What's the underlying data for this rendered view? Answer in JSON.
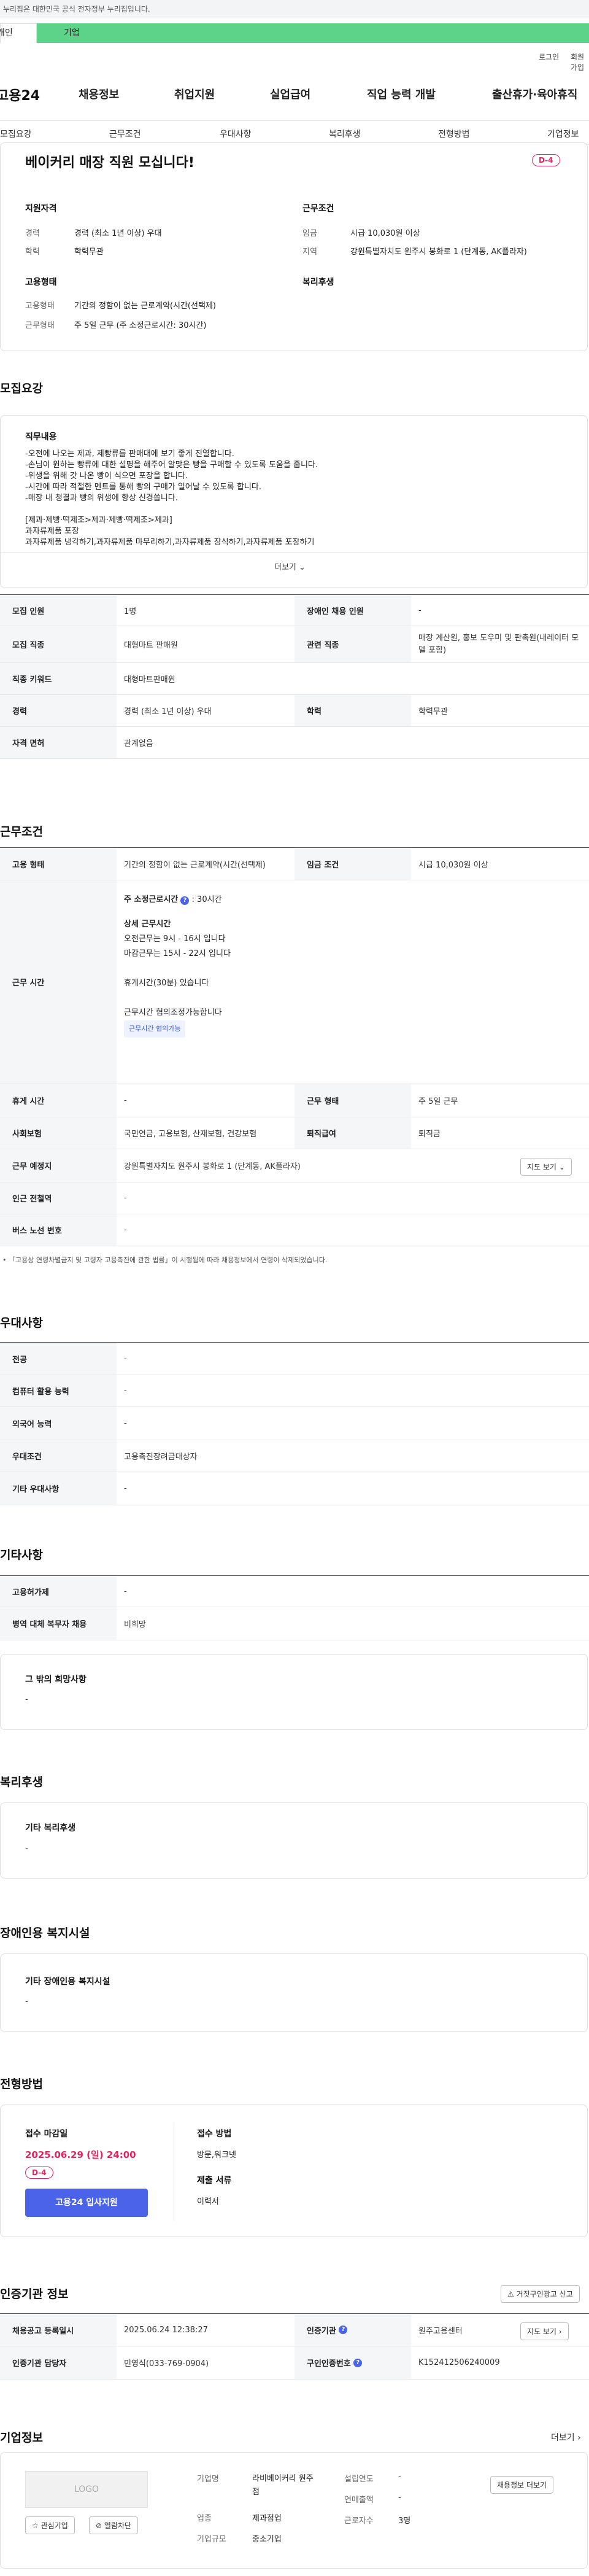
{
  "gov_banner": "이 누리집은 대한민국 공식 전자정부 누리집입니다.",
  "tabs": [
    "개인",
    "기업"
  ],
  "util": {
    "login": "로그인",
    "join": "회원가입"
  },
  "logo": "고용24",
  "gnb": [
    "채용정보",
    "취업지원",
    "실업급여",
    "직업 능력 개발",
    "출산휴가·육아휴직"
  ],
  "subnav": [
    "모집요강",
    "근무조건",
    "우대사항",
    "복리후생",
    "전형방법",
    "기업정보"
  ],
  "header_card": {
    "title": "베이커리 매장 직원 모십니다!",
    "dday": "D-4",
    "qual_title": "지원자격",
    "cond_title": "근무조건",
    "career_k": "경력",
    "career_v": "경력 (최소 1년 이상) 우대",
    "edu_k": "학력",
    "edu_v": "학력무관",
    "wage_k": "임금",
    "wage_v": "시급 10,030원 이상",
    "region_k": "지역",
    "region_v": "강원특별자치도 원주시 봉화로 1 (단계동, AK플라자)",
    "emp_title": "고용형태",
    "welfare_title": "복리후생",
    "emptype_k": "고용형태",
    "emptype_v": "기간의 정함이 없는 근로계약(시간(선택제)",
    "worktype_k": "근무형태",
    "worktype_v": "주 5일 근무 (주 소정근로시간: 30시간)"
  },
  "recruit": {
    "section": "모집요강",
    "duty_title": "직무내용",
    "lines": [
      "-오전에 나오는 제과, 제빵류를 판매대에 보기 좋게 진열합니다.",
      "-손님이 원하는 빵류에 대한 설명을 해주어 알맞은 빵을 구매할 수 있도록 도움을 줍니다.",
      "-위생을 위해 갓 나온 빵이 식으면 포장을 합니다.",
      "-시간에 따라 적절한 멘트를 통해 빵의 구매가 일어날 수 있도록 합니다.",
      "-매장 내 청결과 빵의 위생에 항상 신경씁니다.",
      "",
      "[제과·제빵·떡제조>제과·제빵·떡제조>제과]",
      "과자류제품 포장",
      "과자류제품 냉각하기,과자류제품 마무리하기,과자류제품 장식하기,과자류제품 포장하기"
    ],
    "more": "더보기",
    "rows": [
      {
        "k": "모집 인원",
        "v": "1명",
        "k2": "장애인 채용 인원",
        "v2": "-"
      },
      {
        "k": "모집 직종",
        "v": "대형마트 판매원",
        "k2": "관련 직종",
        "v2": "매장 계산원, 홍보 도우미 및 판촉원(내레이터 모델 포함)"
      },
      {
        "k": "직종 키워드",
        "v": "대형마트판매원"
      },
      {
        "k": "경력",
        "v": "경력 (최소 1년 이상) 우대",
        "k2": "학력",
        "v2": "학력무관"
      },
      {
        "k": "자격 면허",
        "v": "관계없음"
      }
    ]
  },
  "cond": {
    "section": "근무조건",
    "emptype_k": "고용 형태",
    "emptype_v": "기간의 정함이 없는 근로계약(시간(선택제)",
    "wage_k": "임금 조건",
    "wage_v": "시급 10,030원 이상",
    "time_k": "근무 시간",
    "weekly_label": "주 소정근로시간",
    "weekly_val": ": 30시간",
    "detail_title": "상세 근무시간",
    "detail": [
      "오전근무는 9시 - 16시 입니다",
      "마감근무는 15시 - 22시 입니다",
      "",
      "휴게시간(30분) 있습니다",
      "",
      "근무시간 협의조정가능합니다"
    ],
    "time_tag": "근무시간 협의가능",
    "rest_k": "휴게 시간",
    "rest_v": "-",
    "form_k": "근무 형태",
    "form_v": "주 5일 근무",
    "ins_k": "사회보험",
    "ins_v": "국민연금, 고용보험, 산재보험, 건강보험",
    "sev_k": "퇴직급여",
    "sev_v": "퇴직금",
    "place_k": "근무 예정지",
    "place_v": "강원특별자치도 원주시 봉화로 1 (단계동, AK플라자)",
    "map_btn": "지도 보기",
    "subway_k": "인근 전철역",
    "subway_v": "-",
    "bus_k": "버스 노선 번호",
    "bus_v": "-",
    "note": "「고용상 연령차별금지 및 고령자 고용촉진에 관한 법률」이 시행됨에 따라 채용정보에서 연령이 삭제되었습니다."
  },
  "pref": {
    "section": "우대사항",
    "rows": [
      {
        "k": "전공",
        "v": "-"
      },
      {
        "k": "컴퓨터 활용 능력",
        "v": "-"
      },
      {
        "k": "외국어 능력",
        "v": "-"
      },
      {
        "k": "우대조건",
        "v": "고용촉진장려금대상자"
      },
      {
        "k": "기타 우대사항",
        "v": "-"
      }
    ]
  },
  "etc": {
    "section": "기타사항",
    "rows": [
      {
        "k": "고용허가제",
        "v": "-"
      },
      {
        "k": "병역 대체 복무자 채용",
        "v": "비희망"
      }
    ],
    "wish_title": "그 밖의 희망사항",
    "wish_v": "-"
  },
  "welfare": {
    "section": "복리후생",
    "box_title": "기타 복리후생",
    "box_v": "-"
  },
  "disabled": {
    "section": "장애인용 복지시설",
    "box_title": "기타 장애인용 복지시설",
    "box_v": "-"
  },
  "process": {
    "section": "전형방법",
    "deadline_title": "접수 마감일",
    "deadline": "2025.06.29 (일) 24:00",
    "dday": "D-4",
    "apply_btn": "고용24 입사지원",
    "method_title": "접수 방법",
    "method_v": "방문,워크넷",
    "docs_title": "제출 서류",
    "docs_v": "이력서"
  },
  "cert": {
    "section": "인증기관 정보",
    "report_btn": "거짓구인광고 신고",
    "reg_k": "채용공고 등록일시",
    "reg_v": "2025.06.24 12:38:27",
    "org_k": "인증기관",
    "org_v": "원주고용센터",
    "map_btn": "지도 보기",
    "mgr_k": "인증기관 담당자",
    "mgr_v": "민영식(033-769-0904)",
    "no_k": "구인인증번호",
    "no_v": "K152412506240009"
  },
  "company": {
    "section": "기업정보",
    "more": "더보기",
    "logo": "LOGO",
    "fav_btn": "관심기업",
    "block_btn": "열람차단",
    "name_k": "기업명",
    "name_v": "라비베이커리 원주점",
    "ind_k": "업종",
    "ind_v": "제과점업",
    "size_k": "기업규모",
    "size_v": "중소기업",
    "year_k": "설립연도",
    "year_v": "-",
    "sales_k": "연매출액",
    "sales_v": "-",
    "staff_k": "근로자수",
    "staff_v": "3명",
    "jobs_btn": "채용정보 더보기"
  }
}
